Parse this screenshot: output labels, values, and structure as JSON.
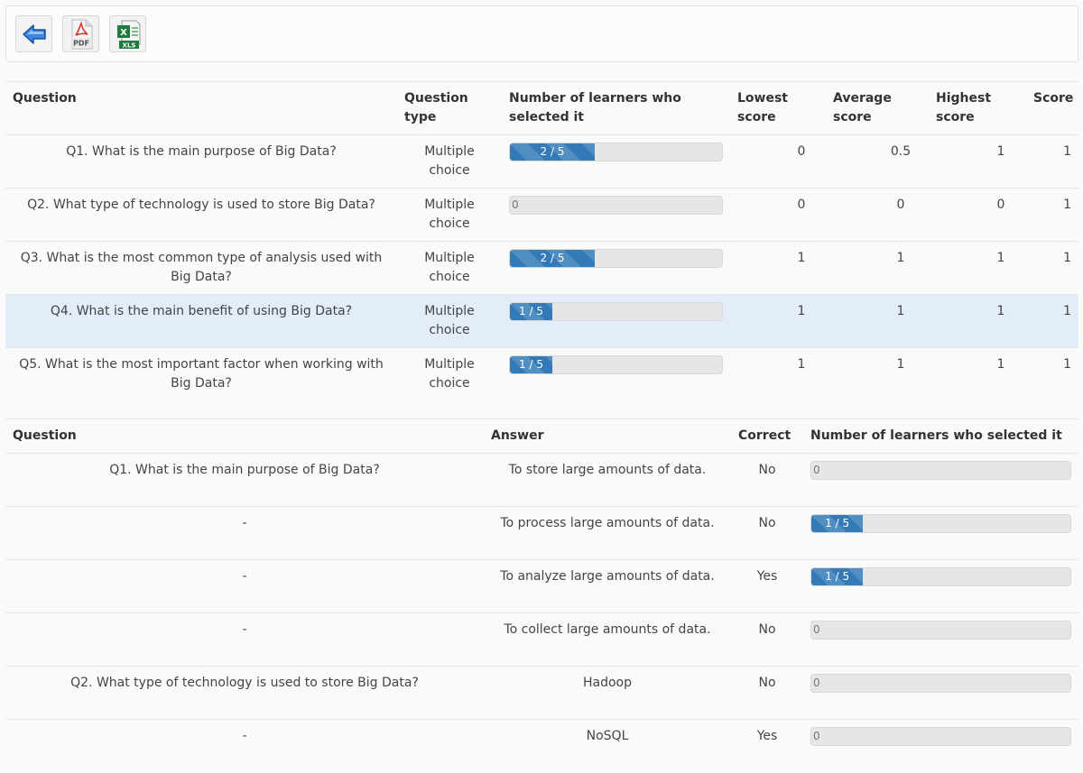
{
  "toolbar": {
    "back_icon": "back-arrow-icon",
    "pdf_label": "PDF",
    "xls_label": "XLS"
  },
  "summary": {
    "headers": [
      "Question",
      "Question type",
      "Number of learners who selected it",
      "Lowest score",
      "Average score",
      "Highest score",
      "Score"
    ],
    "rows": [
      {
        "question": "Q1. What is the main purpose of Big Data?",
        "type": "Multiple choice",
        "selected": "2 / 5",
        "fraction": 0.4,
        "lowest": "0",
        "average": "0.5",
        "highest": "1",
        "score": "1"
      },
      {
        "question": "Q2. What type of technology is used to store Big Data?",
        "type": "Multiple choice",
        "selected": "0",
        "fraction": 0,
        "lowest": "0",
        "average": "0",
        "highest": "0",
        "score": "1"
      },
      {
        "question": "Q3. What is the most common type of analysis used with Big Data?",
        "type": "Multiple choice",
        "selected": "2 / 5",
        "fraction": 0.4,
        "lowest": "1",
        "average": "1",
        "highest": "1",
        "score": "1"
      },
      {
        "question": "Q4. What is the main benefit of using Big Data?",
        "type": "Multiple choice",
        "selected": "1 / 5",
        "fraction": 0.2,
        "lowest": "1",
        "average": "1",
        "highest": "1",
        "score": "1"
      },
      {
        "question": "Q5. What is the most important factor when working with Big Data?",
        "type": "Multiple choice",
        "selected": "1 / 5",
        "fraction": 0.2,
        "lowest": "1",
        "average": "1",
        "highest": "1",
        "score": "1"
      }
    ]
  },
  "answers": {
    "headers": [
      "Question",
      "Answer",
      "Correct",
      "Number of learners who selected it"
    ],
    "rows": [
      {
        "question": "Q1. What is the main purpose of Big Data?",
        "answer": "To store large amounts of data.",
        "correct": "No",
        "selected": "0",
        "fraction": 0
      },
      {
        "question": "-",
        "answer": "To process large amounts of data.",
        "correct": "No",
        "selected": "1 / 5",
        "fraction": 0.2
      },
      {
        "question": "-",
        "answer": "To analyze large amounts of data.",
        "correct": "Yes",
        "selected": "1 / 5",
        "fraction": 0.2
      },
      {
        "question": "-",
        "answer": "To collect large amounts of data.",
        "correct": "No",
        "selected": "0",
        "fraction": 0
      },
      {
        "question": "Q2. What type of technology is used to store Big Data?",
        "answer": "Hadoop",
        "correct": "No",
        "selected": "0",
        "fraction": 0
      },
      {
        "question": "-",
        "answer": "NoSQL",
        "correct": "Yes",
        "selected": "0",
        "fraction": 0
      }
    ]
  },
  "colors": {
    "bar_fill": "#337ab7",
    "highlight_row": "#e3ecf9"
  }
}
